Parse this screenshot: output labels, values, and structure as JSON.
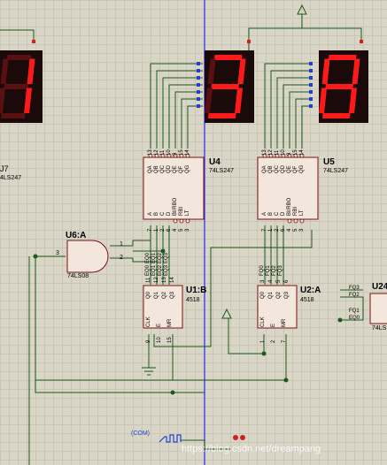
{
  "colors": {
    "background": "#d9d6c7",
    "grid": "#c9c6b6",
    "wire": "#1a5a1a",
    "chip_fill": "#f3e6dc",
    "chip_border": "#7a1010",
    "display_bg": "#1a0a0a",
    "segment_on": "#ff1a1a",
    "segment_off": "#5a1010",
    "cursor_line": "#2a2aff",
    "pin_red": "#d02020",
    "pin_blue": "#2040d0"
  },
  "displays": {
    "left": {
      "digit": "1"
    },
    "middle": {
      "digit": "3"
    },
    "right": {
      "digit": "8"
    }
  },
  "components": {
    "u7_label": "J7",
    "u7_type": "4LS247",
    "u4": {
      "ref": "U4",
      "type": "74LS247",
      "top_pins": [
        "QA",
        "QB",
        "QC",
        "QD",
        "QE",
        "QF",
        "QG"
      ],
      "top_nums": [
        "13",
        "12",
        "11",
        "10",
        "9",
        "15",
        "14"
      ],
      "left_pins": [
        "A",
        "B",
        "C",
        "D"
      ],
      "right_pins": [
        "BI/RBO",
        "RBI",
        "LT"
      ],
      "bottom_nums": [
        "7",
        "1",
        "2",
        "6",
        "4",
        "5",
        "3"
      ]
    },
    "u5": {
      "ref": "U5",
      "type": "74LS247",
      "top_pins": [
        "QA",
        "QB",
        "QC",
        "QD",
        "QE",
        "QF",
        "QG"
      ],
      "top_nums": [
        "13",
        "12",
        "11",
        "10",
        "9",
        "15",
        "14"
      ],
      "left_pins": [
        "A",
        "B",
        "C",
        "D"
      ],
      "right_pins": [
        "BI/RBO",
        "RBI",
        "LT"
      ],
      "bottom_nums": [
        "7",
        "1",
        "2",
        "6",
        "4",
        "5",
        "3"
      ]
    },
    "u6a": {
      "ref": "U6:A",
      "type": "74LS08",
      "pin_in1": "1",
      "pin_in2": "2",
      "pin_out": "3"
    },
    "u1b": {
      "ref": "U1:B",
      "type": "4518",
      "top_pins": [
        "Q0",
        "Q1",
        "Q2",
        "Q3"
      ],
      "top_nums": [
        "11",
        "12",
        "13",
        "14"
      ],
      "bottom_pins": [
        "CLK",
        "E",
        "MR"
      ],
      "bottom_nums": [
        "9",
        "10",
        "15"
      ]
    },
    "u2a": {
      "ref": "U2:A",
      "type": "4518",
      "top_pins": [
        "Q0",
        "Q1",
        "Q2",
        "Q3"
      ],
      "top_nums": [
        "3",
        "4",
        "5",
        "6"
      ],
      "bottom_pins": [
        "CLK",
        "E",
        "MR"
      ],
      "bottom_nums": [
        "1",
        "2",
        "7"
      ]
    },
    "u24": {
      "ref": "U24",
      "type": "74LS",
      "pins": [
        "FQ3",
        "FQ2",
        "FQ1",
        "EQ0"
      ]
    }
  },
  "net_labels": {
    "u6_inputs": [
      "EQ0",
      "EQ1",
      "EQ2",
      "EQ3"
    ],
    "u1_q": [
      "EQ0",
      "EQ1",
      "EQ2",
      "EQ3"
    ],
    "u2_q": [
      "FQ0",
      "FQ1",
      "FQ2",
      "FQ3"
    ]
  },
  "clock": {
    "label": "(COM)"
  },
  "watermark": "https://blog.csdn.net/dreampang"
}
